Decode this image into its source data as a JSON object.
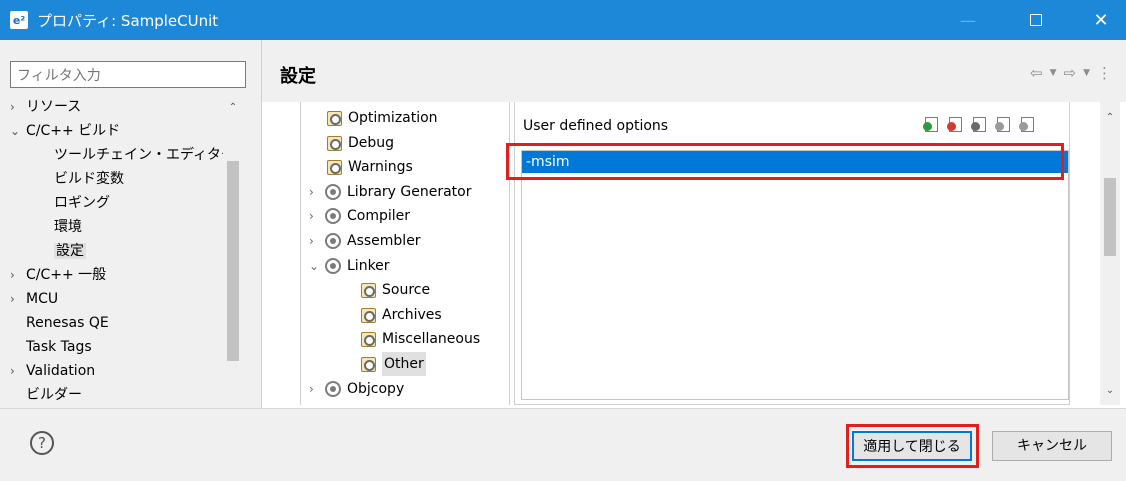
{
  "window": {
    "app_icon": "e²",
    "title": "プロパティ: SampleCUnit",
    "minimize_icon": "—",
    "close_icon": "✕"
  },
  "left": {
    "filter_placeholder": "フィルタ入力",
    "tree": [
      {
        "label": "リソース",
        "chevron": "›",
        "indent": 0
      },
      {
        "label": "C/C++ ビルド",
        "chevron": "⌄",
        "indent": 0
      },
      {
        "label": "ツールチェイン・エディター",
        "chevron": "",
        "indent": 1
      },
      {
        "label": "ビルド変数",
        "chevron": "",
        "indent": 1
      },
      {
        "label": "ロギング",
        "chevron": "",
        "indent": 1
      },
      {
        "label": "環境",
        "chevron": "",
        "indent": 1
      },
      {
        "label": "設定",
        "chevron": "",
        "indent": 1,
        "selected": true
      },
      {
        "label": "C/C++ 一般",
        "chevron": "›",
        "indent": 0
      },
      {
        "label": "MCU",
        "chevron": "›",
        "indent": 0
      },
      {
        "label": "Renesas QE",
        "chevron": "",
        "indent": 0
      },
      {
        "label": "Task Tags",
        "chevron": "",
        "indent": 0
      },
      {
        "label": "Validation",
        "chevron": "›",
        "indent": 0
      },
      {
        "label": "ビルダー",
        "chevron": "",
        "indent": 0
      }
    ]
  },
  "header": {
    "page_title": "設定",
    "back_icon": "⇦",
    "forward_icon": "⇨",
    "dropdown_icon": "▼",
    "menu_icon": "⋮"
  },
  "tool_tree": [
    {
      "label": "Optimization",
      "icon": "page",
      "chevron": ""
    },
    {
      "label": "Debug",
      "icon": "page",
      "chevron": ""
    },
    {
      "label": "Warnings",
      "icon": "page",
      "chevron": ""
    },
    {
      "label": "Library Generator",
      "icon": "gear",
      "chevron": "›"
    },
    {
      "label": "Compiler",
      "icon": "gear",
      "chevron": "›"
    },
    {
      "label": "Assembler",
      "icon": "gear",
      "chevron": "›"
    },
    {
      "label": "Linker",
      "icon": "gear",
      "chevron": "⌄"
    },
    {
      "label": "Source",
      "icon": "page",
      "chevron": "",
      "child": true
    },
    {
      "label": "Archives",
      "icon": "page",
      "chevron": "",
      "child": true
    },
    {
      "label": "Miscellaneous",
      "icon": "page",
      "chevron": "",
      "child": true
    },
    {
      "label": "Other",
      "icon": "page",
      "chevron": "",
      "child": true,
      "selected": true
    },
    {
      "label": "Objcopy",
      "icon": "gear",
      "chevron": "›"
    }
  ],
  "options": {
    "label": "User defined options",
    "items": [
      "-msim"
    ],
    "toolbar": [
      {
        "name": "add-icon",
        "color": "#2e9b3a"
      },
      {
        "name": "delete-icon",
        "color": "#d23a2a"
      },
      {
        "name": "edit-icon",
        "color": "#6b6b6b"
      },
      {
        "name": "move-up-icon",
        "color": "#9a9a9a"
      },
      {
        "name": "move-down-icon",
        "color": "#9a9a9a"
      }
    ]
  },
  "footer": {
    "help_icon": "?",
    "apply_close_label": "適用して閉じる",
    "cancel_label": "キャンセル"
  },
  "colors": {
    "titlebar": "#1e88d8",
    "selection": "#0078d7",
    "highlight": "#e0201d"
  }
}
